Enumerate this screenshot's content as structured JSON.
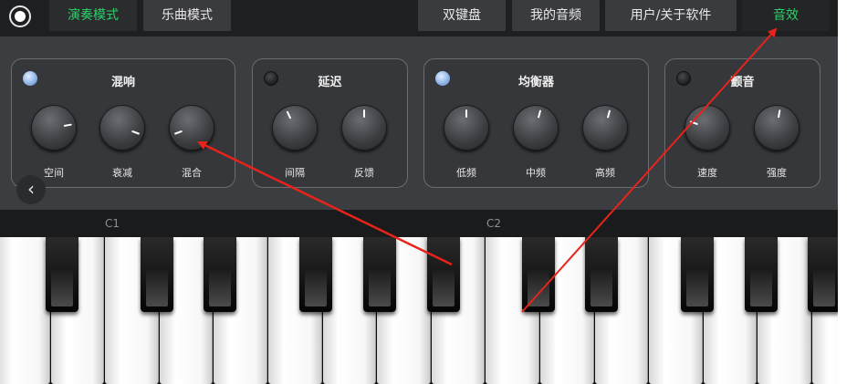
{
  "topbar": {
    "left_tabs": [
      {
        "label": "演奏模式",
        "active": true
      },
      {
        "label": "乐曲模式",
        "active": false
      }
    ],
    "right_tabs": [
      {
        "label": "双键盘",
        "active": false
      },
      {
        "label": "我的音频",
        "active": false
      },
      {
        "label": "用户/关于软件",
        "active": false
      },
      {
        "label": "音效",
        "active": true
      }
    ]
  },
  "effects": [
    {
      "title": "混响",
      "enabled": true,
      "knobs": [
        "空间",
        "衰减",
        "混合"
      ]
    },
    {
      "title": "延迟",
      "enabled": false,
      "knobs": [
        "间隔",
        "反馈"
      ]
    },
    {
      "title": "均衡器",
      "enabled": true,
      "knobs": [
        "低频",
        "中频",
        "高频"
      ]
    },
    {
      "title": "颤音",
      "enabled": false,
      "knobs": [
        "速度",
        "强度"
      ]
    }
  ],
  "octaves": [
    "C1",
    "C2"
  ],
  "colors": {
    "accent": "#2ed06a",
    "annotation": "#e8231a",
    "led_on": "#9fc0ef"
  }
}
